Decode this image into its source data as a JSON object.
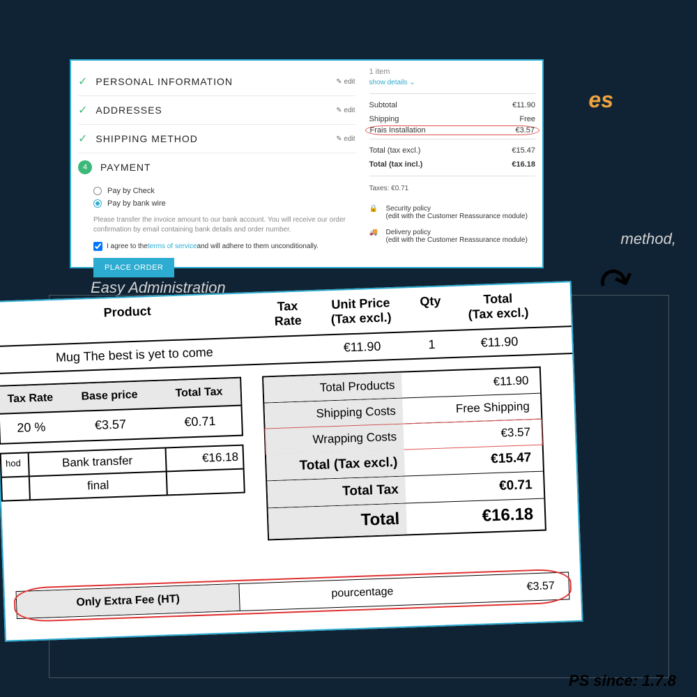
{
  "bg": {
    "es": "es",
    "method": "method,",
    "easy": "Easy Administration"
  },
  "steps": [
    {
      "title": "PERSONAL INFORMATION",
      "edit": "✎ edit"
    },
    {
      "title": "ADDRESSES",
      "edit": "✎ edit"
    },
    {
      "title": "SHIPPING METHOD",
      "edit": "✎ edit"
    }
  ],
  "step4": {
    "num": "4",
    "title": "PAYMENT"
  },
  "payments": {
    "check": "Pay by Check",
    "wire": "Pay by bank wire",
    "note": "Please transfer the invoice amount to our bank account. You will receive our order confirmation by email containing bank details and order number."
  },
  "terms": {
    "pre": "I agree to the ",
    "link": "terms of service",
    "post": " and will adhere to them unconditionally."
  },
  "order_btn": "PLACE ORDER",
  "summary": {
    "items": "1 item",
    "show": "show details  ⌄",
    "subtotal": {
      "label": "Subtotal",
      "val": "€11.90"
    },
    "shipping": {
      "label": "Shipping",
      "val": "Free"
    },
    "fee": {
      "label": "Frais Installation",
      "val": "€3.57"
    },
    "total_excl": {
      "label": "Total (tax excl.)",
      "val": "€15.47"
    },
    "total_incl": {
      "label": "Total (tax incl.)",
      "val": "€16.18"
    },
    "taxes": "Taxes: €0.71"
  },
  "policy": {
    "sec": {
      "title": "Security policy",
      "sub": "(edit with the Customer Reassurance module)"
    },
    "del": {
      "title": "Delivery policy",
      "sub": "(edit with the Customer Reassurance module)"
    }
  },
  "inv": {
    "head": {
      "product": "Product",
      "tax": "Tax Rate",
      "unit": "Unit Price (Tax excl.)",
      "qty": "Qty",
      "total": "Total (Tax excl.)"
    },
    "row": {
      "product": "Mug The best is yet to come",
      "unit": "€11.90",
      "qty": "1",
      "total": "€11.90"
    }
  },
  "tax_table": {
    "head": {
      "rate": "Tax Rate",
      "base": "Base price",
      "total": "Total Tax"
    },
    "row": {
      "rate": "20 %",
      "base": "€3.57",
      "total": "€0.71"
    }
  },
  "pay_table": {
    "hod": "hod",
    "method": "Bank transfer",
    "amount": "€16.18",
    "final": "final"
  },
  "totals": {
    "products": {
      "label": "Total Products",
      "val": "€11.90"
    },
    "shipping": {
      "label": "Shipping Costs",
      "val": "Free Shipping"
    },
    "wrapping": {
      "label": "Wrapping Costs",
      "val": "€3.57"
    },
    "excl": {
      "label": "Total (Tax excl.)",
      "val": "€15.47"
    },
    "tax": {
      "label": "Total Tax",
      "val": "€0.71"
    },
    "total": {
      "label": "Total",
      "val": "€16.18"
    }
  },
  "extra": {
    "label": "Only Extra Fee (HT)",
    "mode": "pourcentage",
    "val": "€3.57"
  },
  "ps": "PS since: 1.7.8"
}
